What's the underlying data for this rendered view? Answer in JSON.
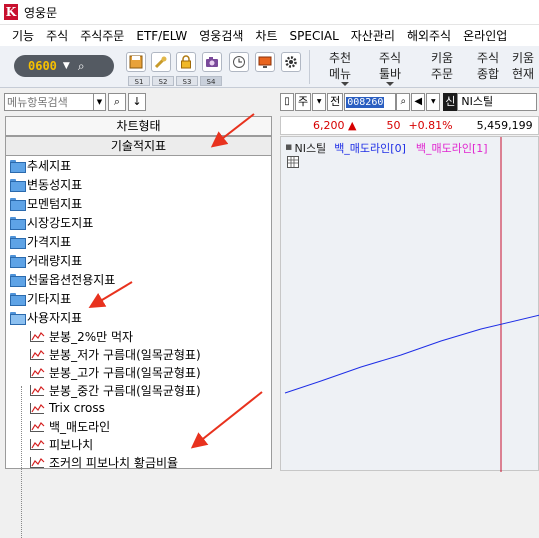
{
  "window": {
    "title": "영웅문"
  },
  "menubar": {
    "items": [
      "기능",
      "주식",
      "주식주문",
      "ETF/ELW",
      "영웅검색",
      "차트",
      "SPECIAL",
      "자산관리",
      "해외주식",
      "온라인업"
    ]
  },
  "toolbar": {
    "screen_code": "0600",
    "slots": [
      "S1",
      "S2",
      "S3",
      "S4"
    ],
    "buttons": [
      {
        "line1": "추천",
        "line2": "메뉴"
      },
      {
        "line1": "주식",
        "line2": "툴바"
      },
      {
        "line1": "키움",
        "line2": "주문"
      },
      {
        "line1": "주식",
        "line2": "종합"
      },
      {
        "line1": "키움",
        "line2": "현재"
      }
    ]
  },
  "left": {
    "search_placeholder": "메뉴항목검색",
    "tab_chart_type": "차트형태",
    "tab_tech_indicator": "기술적지표",
    "folders": [
      "추세지표",
      "변동성지표",
      "모멘텀지표",
      "시장강도지표",
      "가격지표",
      "거래량지표",
      "선물옵션전용지표",
      "기타지표"
    ],
    "user_folder": "사용자지표",
    "user_items": [
      "분봉_2%만 먹자",
      "분봉_저가 구름대(일목균형표)",
      "분봉_고가 구름대(일목균형표)",
      "분봉_중간 구름대(일목균형표)",
      "Trix cross",
      "백_매도라인",
      "피보나치",
      "조커의 피보나치 황금비율"
    ]
  },
  "right": {
    "combo1": "주",
    "combo2": "전",
    "stock_code": "008260",
    "stock_flag": "신",
    "stock_name": "NI스틸",
    "price": "6,200",
    "price_arrow": "▲",
    "change": "50",
    "change_rate": "+0.81%",
    "volume": "5,459,199",
    "legend_stock": "NI스틸",
    "legend_series_0": "백_매도라인[0]",
    "legend_series_1": "백_매도라인[1]"
  },
  "colors": {
    "series0": "#1e2ee6",
    "series1": "#e024d0",
    "up": "#d60000",
    "arrow": "#e8321e"
  }
}
